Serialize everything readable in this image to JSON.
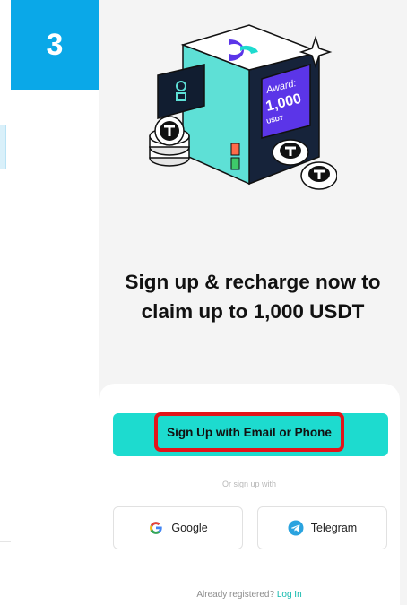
{
  "step_badge": "3",
  "promo": {
    "award_label": "Award:",
    "award_amount": "1,000",
    "award_currency": "USDT",
    "headline_line1": "Sign up & recharge now to",
    "headline_line2": "claim up to 1,000 USDT"
  },
  "signup": {
    "primary_label": "Sign Up with Email or Phone",
    "divider_text": "Or sign up with",
    "google_label": "Google",
    "telegram_label": "Telegram"
  },
  "footer": {
    "prompt": "Already registered?",
    "login_label": "Log In"
  },
  "colors": {
    "accent": "#1ddbcf",
    "step_badge": "#0aa8e8",
    "highlight_border": "#e3141a",
    "brand_purple": "#5b35e8",
    "link": "#13b9ad"
  },
  "icons": [
    "google-icon",
    "telegram-icon"
  ]
}
